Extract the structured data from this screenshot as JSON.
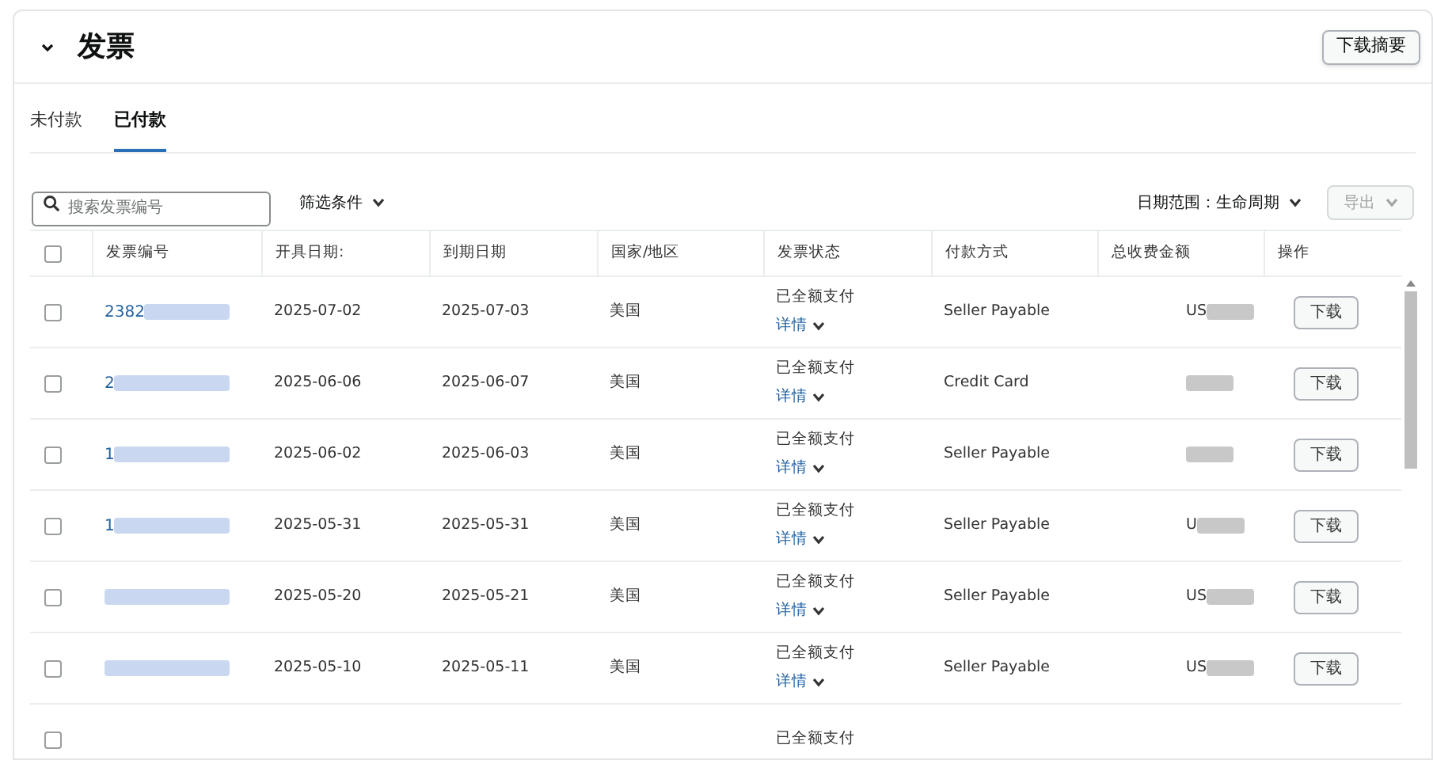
{
  "header": {
    "title": "发票",
    "expanded": true,
    "button": "下载摘要"
  },
  "tabs": [
    {
      "label": "未付款",
      "selected": false
    },
    {
      "label": "已付款",
      "selected": true
    }
  ],
  "toolbar": {
    "search": {
      "placeholder": "搜索发票编号"
    },
    "filter": "筛选条件",
    "date_range": "日期范围：生命周期",
    "export": {
      "label": "导出",
      "disabled": true
    }
  },
  "table": {
    "select_all_checked": false,
    "columns": [
      "发票编号",
      "开具日期:",
      "到期日期",
      "国家/地区",
      "发票状态",
      "付款方式",
      "总收费金额",
      "操作"
    ],
    "rows": [
      {
        "checked": false,
        "number": "2382",
        "issued": "2025-07-02",
        "due": "2025-07-03",
        "country": "美国",
        "status": "已全额支付",
        "details": "详情",
        "payment": "Seller Payable",
        "amount": "US",
        "action": "下载"
      },
      {
        "checked": false,
        "number": "2",
        "issued": "2025-06-06",
        "due": "2025-06-07",
        "country": "美国",
        "status": "已全额支付",
        "details": "详情",
        "payment": "Credit Card",
        "action": "下载"
      },
      {
        "checked": false,
        "number": "1",
        "issued": "2025-06-02",
        "due": "2025-06-03",
        "country": "美国",
        "status": "已全额支付",
        "details": "详情",
        "payment": "Seller Payable",
        "action": "下载"
      },
      {
        "checked": false,
        "number": "1",
        "issued": "2025-05-31",
        "due": "2025-05-31",
        "country": "美国",
        "status": "已全额支付",
        "details": "详情",
        "payment": "Seller Payable",
        "amount": "U",
        "action": "下载"
      },
      {
        "checked": false,
        "issued": "2025-05-20",
        "due": "2025-05-21",
        "country": "美国",
        "status": "已全额支付",
        "details": "详情",
        "payment": "Seller Payable",
        "amount": "US",
        "action": "下载"
      },
      {
        "checked": false,
        "issued": "2025-05-10",
        "due": "2025-05-11",
        "country": "美国",
        "status": "已全额支付",
        "details": "详情",
        "payment": "Seller Payable",
        "amount": "US",
        "action": "下载"
      },
      {
        "checked": false,
        "status": "已全额支付"
      }
    ]
  }
}
